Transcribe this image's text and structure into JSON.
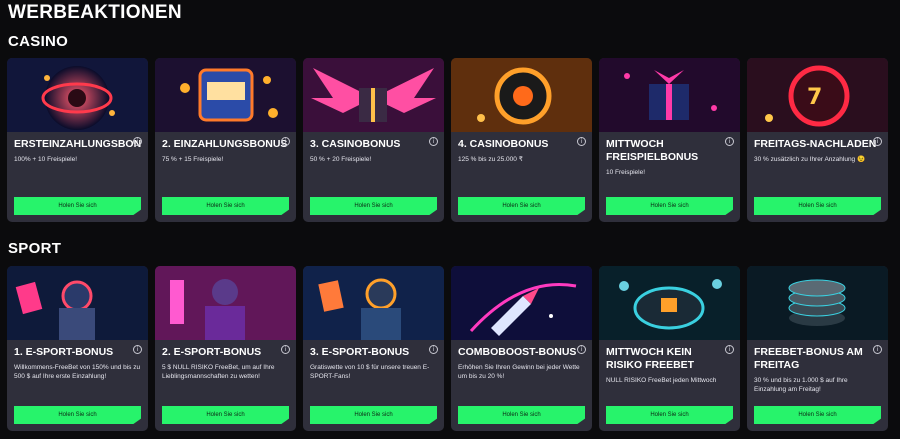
{
  "page_title": "WERBEAKTIONEN",
  "sections": [
    {
      "title": "CASINO",
      "cards": [
        {
          "title": "ERSTEINZAHLUNGSBON",
          "desc": "100% + 10 Freispiele!",
          "cta": "Holen Sie sich",
          "image_icon": "roulette-icon"
        },
        {
          "title": "2. EINZAHLUNGSBONUS",
          "desc": "75 % + 15 Freispiele!",
          "cta": "Holen Sie sich",
          "image_icon": "slot-machine-icon"
        },
        {
          "title": "3. CASINOBONUS",
          "desc": "50 % + 20 Freispiele!",
          "cta": "Holen Sie sich",
          "image_icon": "winged-gift-icon"
        },
        {
          "title": "4. CASINOBONUS",
          "desc": "125 % bis zu 25.000 ₹",
          "cta": "Holen Sie sich",
          "image_icon": "slot-reel-icon"
        },
        {
          "title": "MITTWOCH FREISPIELBONUS",
          "desc": "10 Freispiele!",
          "cta": "Holen Sie sich",
          "image_icon": "gift-box-icon"
        },
        {
          "title": "FREITAGS-NACHLADEN",
          "desc": "30 % zusätzlich zu Ihrer Anzahlung 😉",
          "cta": "Holen Sie sich",
          "image_icon": "slot-wheel-icon"
        }
      ]
    },
    {
      "title": "SPORT",
      "cards": [
        {
          "title": "1. E-SPORT-BONUS",
          "desc": "Willkommens-FreeBet von 150% und bis zu 500 $ auf Ihre erste Einzahlung!",
          "cta": "Holen Sie sich",
          "image_icon": "robot-warrior-icon"
        },
        {
          "title": "2. E-SPORT-BONUS",
          "desc": "5 $ NULL RISIKO FreeBet, um auf Ihre Lieblingsmannschaften zu wetten!",
          "cta": "Holen Sie sich",
          "image_icon": "cyber-hero-icon"
        },
        {
          "title": "3. E-SPORT-BONUS",
          "desc": "Gratiswette von 10 $ für unsere treuen E-SPORT-Fans!",
          "cta": "Holen Sie sich",
          "image_icon": "gamer-character-icon"
        },
        {
          "title": "COMBOBOOST-BONUS",
          "desc": "Erhöhen Sie Ihren Gewinn bei jeder Wette um bis zu 20 %!",
          "cta": "Holen Sie sich",
          "image_icon": "rocket-icon"
        },
        {
          "title": "MITTWOCH KEIN RISIKO FREEBET",
          "desc": "NULL RISIKO FreeBet jeden Mittwoch",
          "cta": "Holen Sie sich",
          "image_icon": "casino-chip-icon"
        },
        {
          "title": "FREEBET-BONUS AM FREITAG",
          "desc": "30 % und bis zu 1.000 $ auf Ihre Einzahlung am Freitag!",
          "cta": "Holen Sie sich",
          "image_icon": "chip-stack-icon"
        }
      ]
    }
  ],
  "colors": {
    "background": "#0b0b0d",
    "card": "#2f2f3b",
    "cta": "#27f36b"
  }
}
